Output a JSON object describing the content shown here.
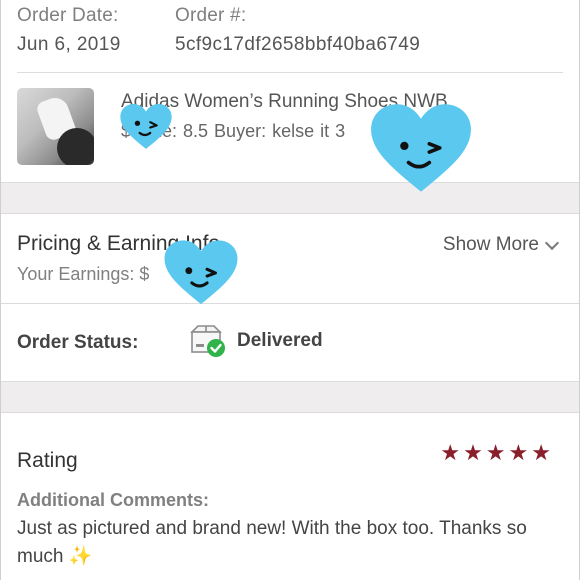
{
  "order": {
    "date_label": "Order Date:",
    "date_value": "Jun 6, 2019",
    "number_label": "Order #:",
    "number_value": "5cf9c17df2658bbf40ba6749"
  },
  "product": {
    "title": "Adidas Women’s Running Shoes NWB",
    "subtitle": "$     Size: 8.5  Buyer: kelse       it    3"
  },
  "pricing": {
    "title": "Pricing & Earning Info",
    "subtitle": "Your Earnings: $",
    "show_more": "Show More"
  },
  "status": {
    "label": "Order Status:",
    "value": "Delivered",
    "icon": "delivered-box-icon"
  },
  "rating": {
    "label": "Rating",
    "stars": 5,
    "star_color": "#8a1f2b"
  },
  "comments": {
    "label": "Additional Comments:",
    "text": "Just as pictured and brand new! With the box too. Thanks so much",
    "emoji": "✨"
  },
  "colors": {
    "heart_sticker": "#5bc8ef",
    "check_green": "#2fb34a",
    "band_bg": "#efeded"
  }
}
